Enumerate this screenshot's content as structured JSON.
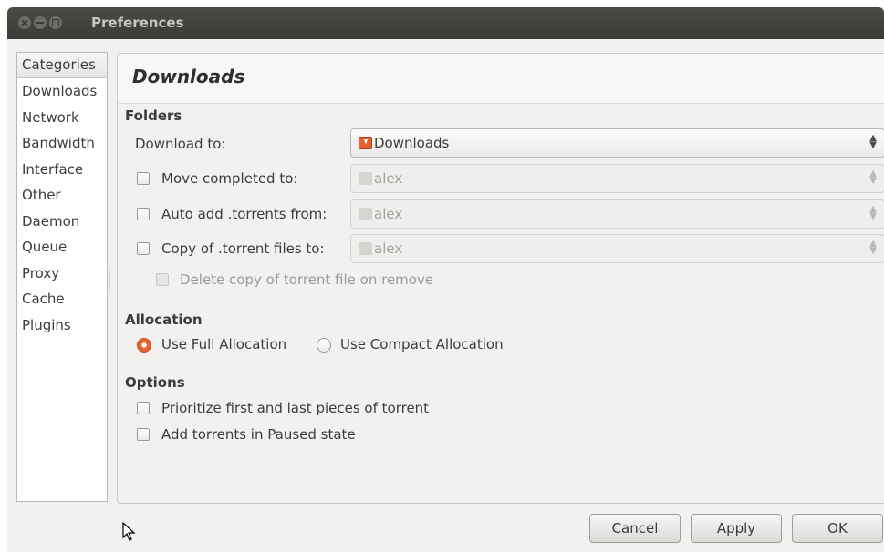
{
  "window": {
    "title": "Preferences"
  },
  "sidebar": {
    "header": "Categories",
    "items": [
      "Downloads",
      "Network",
      "Bandwidth",
      "Interface",
      "Other",
      "Daemon",
      "Queue",
      "Proxy",
      "Cache",
      "Plugins"
    ]
  },
  "panel": {
    "title": "Downloads",
    "folders": {
      "section": "Folders",
      "download_to_label": "Download to:",
      "download_to_value": "Downloads",
      "move_completed_label": "Move completed to:",
      "move_completed_value": "alex",
      "auto_add_label": "Auto add .torrents from:",
      "auto_add_value": "alex",
      "copy_torrent_label": "Copy of .torrent files to:",
      "copy_torrent_value": "alex",
      "delete_copy_label": "Delete copy of torrent file on remove"
    },
    "allocation": {
      "section": "Allocation",
      "full_label": "Use Full Allocation",
      "compact_label": "Use Compact Allocation",
      "selected": "full"
    },
    "options": {
      "section": "Options",
      "prioritize_label": "Prioritize first and last pieces of torrent",
      "paused_label": "Add torrents in Paused state"
    }
  },
  "buttons": {
    "cancel": "Cancel",
    "apply": "Apply",
    "ok": "OK"
  },
  "colors": {
    "accent": "#e6632f",
    "titlebar": "#3c3b37"
  }
}
